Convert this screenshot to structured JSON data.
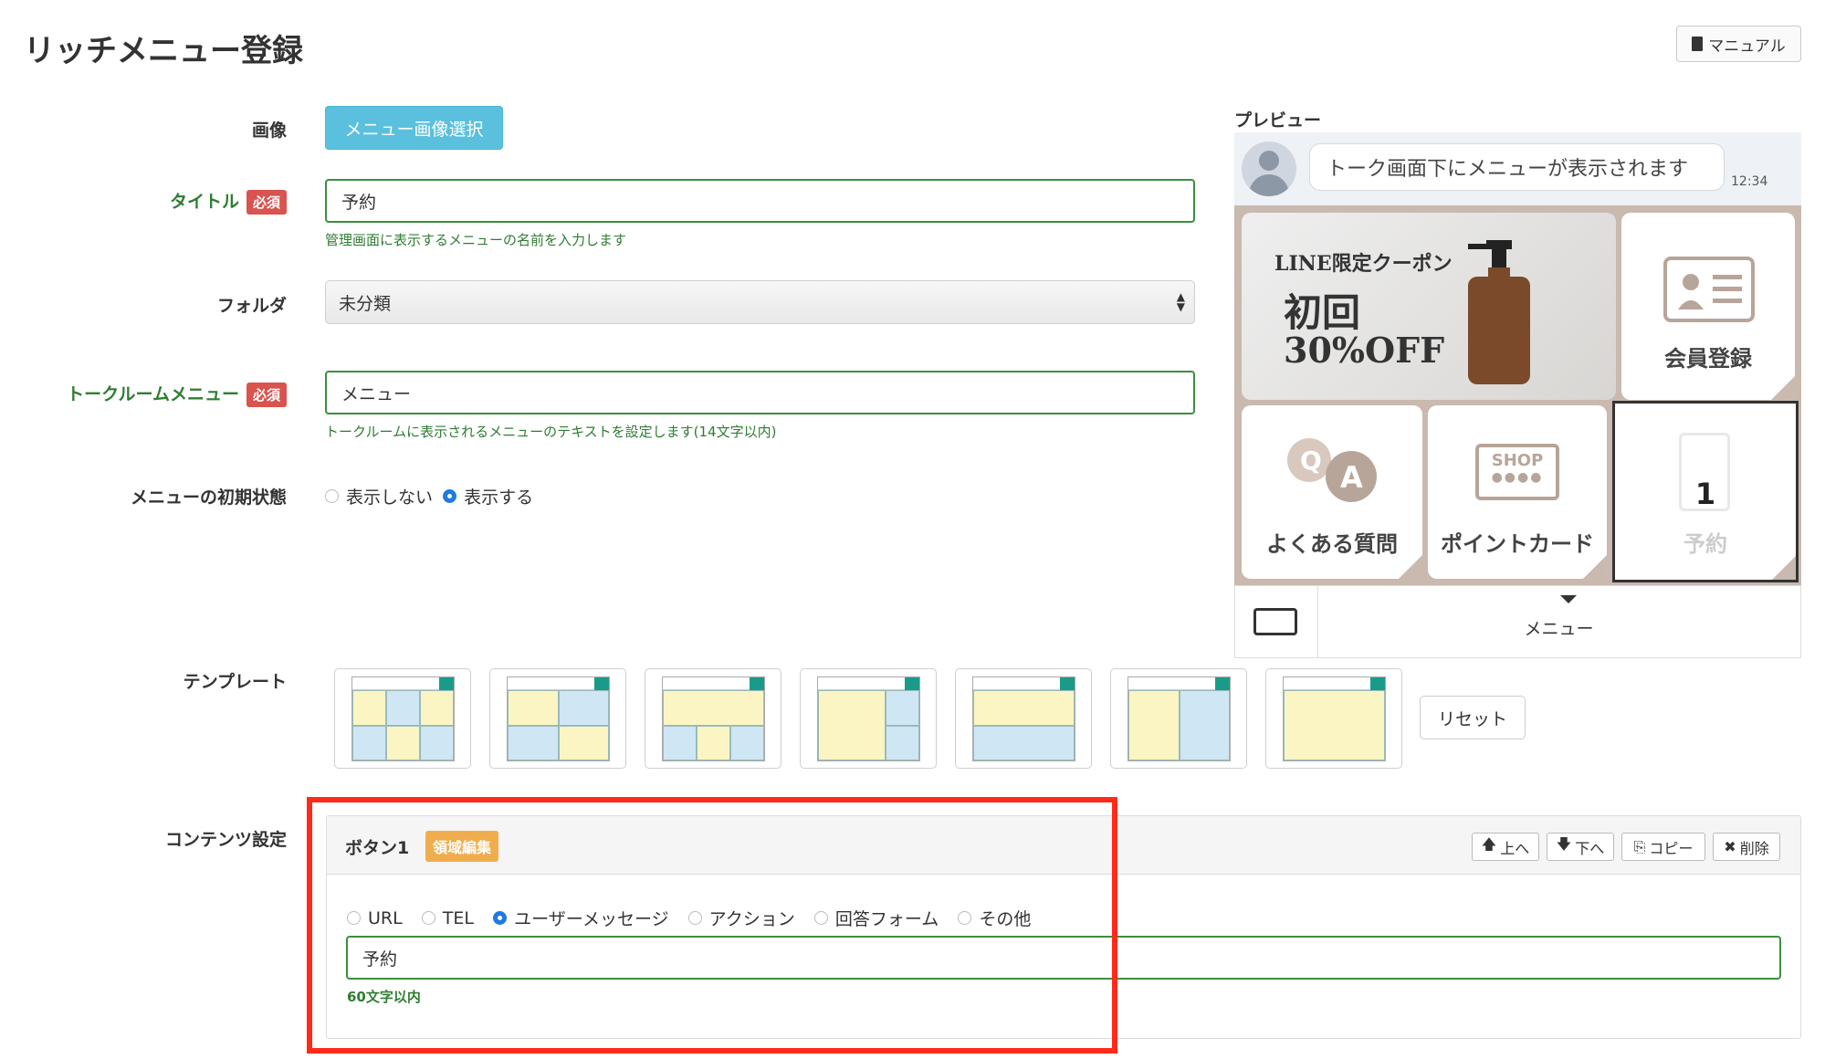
{
  "page": {
    "title": "リッチメニュー登録",
    "manual_label": "マニュアル"
  },
  "form": {
    "image_label": "画像",
    "image_button": "メニュー画像選択",
    "title_label": "タイトル",
    "required_badge": "必須",
    "title_value": "予約",
    "title_help": "管理画面に表示するメニューの名前を入力します",
    "folder_label": "フォルダ",
    "folder_value": "未分類",
    "talkroom_label": "トークルームメニュー",
    "talkroom_value": "メニュー",
    "talkroom_help": "トークルームに表示されるメニューのテキストを設定します(14文字以内)",
    "initial_state_label": "メニューの初期状態",
    "initial_state_options": [
      "表示しない",
      "表示する"
    ],
    "initial_state_selected": "表示する",
    "template_label": "テンプレート",
    "reset_button": "リセット",
    "content_label": "コンテンツ設定"
  },
  "content_panel": {
    "title": "ボタン1",
    "area_badge": "領域編集",
    "tools": {
      "up": "上へ",
      "down": "下へ",
      "copy": "コピー",
      "delete": "削除"
    },
    "action_types": [
      "URL",
      "TEL",
      "ユーザーメッセージ",
      "アクション",
      "回答フォーム",
      "その他"
    ],
    "action_selected": "ユーザーメッセージ",
    "message_value": "予約",
    "message_help": "60文字以内"
  },
  "preview": {
    "label": "プレビュー",
    "bubble_text": "トーク画面下にメニューが表示されます",
    "time": "12:34",
    "coupon": {
      "line1": "LINE限定クーポン",
      "line2": "初回",
      "line3": "30%OFF"
    },
    "tiles": {
      "member": "会員登録",
      "faq": "よくある質問",
      "point": "ポイントカード",
      "shop_text": "SHOP",
      "reserve_num": "1",
      "reserve": "予約"
    },
    "menu_text": "メニュー"
  },
  "colors": {
    "accent_blue": "#5bc0de",
    "green": "#2e7d32",
    "required_red": "#d9534f",
    "badge_orange": "#f0ad4e",
    "highlight_red": "#ff2a1a"
  }
}
